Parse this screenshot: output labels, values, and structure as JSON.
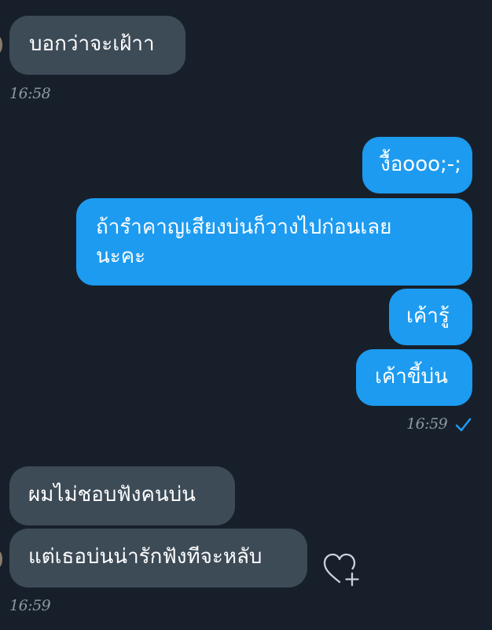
{
  "conversation": {
    "messages": [
      {
        "direction": "incoming",
        "text": "บอกว่าจะเฝ้าา"
      },
      {
        "direction": "outgoing",
        "text": "งื้อooo;-;"
      },
      {
        "direction": "outgoing",
        "text": "ถ้ารำคาญเสียงบ่นก็วางไปก่อนเลย",
        "text_line2": "นะคะ"
      },
      {
        "direction": "outgoing",
        "text": "เค้ารู้"
      },
      {
        "direction": "outgoing",
        "text": "เค้าขี้บ่น"
      },
      {
        "direction": "incoming",
        "text": "ผมไม่ชอบฟังคนบ่น"
      },
      {
        "direction": "incoming",
        "text": "แต่เธอบ่นน่ารักฟังทีจะหลับ"
      }
    ],
    "timestamps": {
      "first": "16:58",
      "second": "16:59",
      "third": "16:59"
    },
    "read_status": "sent",
    "reaction_action": "add-reaction"
  },
  "colors": {
    "background": "#17202a",
    "incoming_bubble": "#3d4b57",
    "outgoing_bubble": "#1d9bf0",
    "timestamp": "#8b98a5",
    "check": "#1d9bf0"
  },
  "icons": {
    "read_indicator": "check-icon",
    "reaction": "heart-plus-icon"
  }
}
